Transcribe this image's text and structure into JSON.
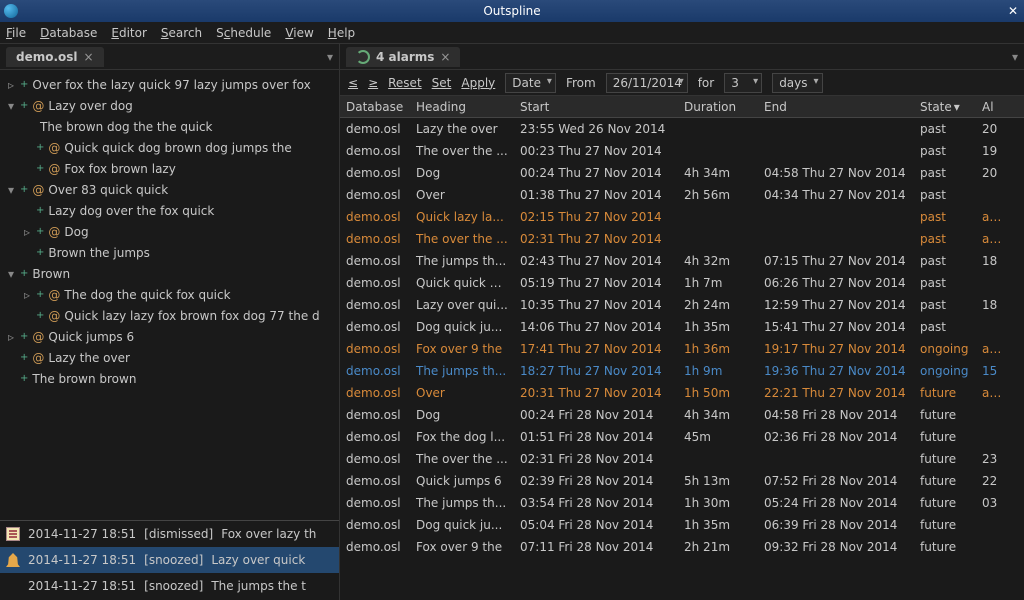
{
  "window": {
    "title": "Outspline"
  },
  "menubar": {
    "file": "File",
    "database": "Database",
    "editor": "Editor",
    "search": "Search",
    "schedule": "Schedule",
    "view": "View",
    "help": "Help"
  },
  "left_tab": {
    "label": "demo.osl"
  },
  "right_tab": {
    "label": "4 alarms"
  },
  "toolbar": {
    "lt": "≤",
    "gt": "≥",
    "reset": "Reset",
    "set": "Set",
    "apply": "Apply",
    "sort": "Date",
    "from_label": "From",
    "date": "26/11/2014",
    "for": "for",
    "days_count": "3",
    "days": "days"
  },
  "tree": [
    {
      "lvl": 0,
      "tw": "▹",
      "b": "+",
      "s": "",
      "text": "Over fox the lazy quick 97 lazy jumps over fox"
    },
    {
      "lvl": 0,
      "tw": "▾",
      "b": "+",
      "s": "@",
      "text": "Lazy over dog"
    },
    {
      "lvl": 1,
      "tw": "",
      "b": "",
      "s": "",
      "text": "The brown dog the the quick"
    },
    {
      "lvl": 1,
      "tw": "",
      "b": "+",
      "s": "@",
      "text": "Quick quick dog brown dog jumps the"
    },
    {
      "lvl": 1,
      "tw": "",
      "b": "+",
      "s": "@",
      "text": "Fox fox brown lazy"
    },
    {
      "lvl": 0,
      "tw": "▾",
      "b": "+",
      "s": "@",
      "text": "Over 83 quick quick"
    },
    {
      "lvl": 1,
      "tw": "",
      "b": "+",
      "s": "",
      "text": "Lazy dog over the fox quick"
    },
    {
      "lvl": 1,
      "tw": "▹",
      "b": "+",
      "s": "@",
      "text": "Dog"
    },
    {
      "lvl": 1,
      "tw": "",
      "b": "+",
      "s": "",
      "text": "Brown the jumps"
    },
    {
      "lvl": 0,
      "tw": "▾",
      "b": "+",
      "s": "",
      "text": "Brown"
    },
    {
      "lvl": 1,
      "tw": "▹",
      "b": "+",
      "s": "@",
      "text": "The dog the quick fox quick"
    },
    {
      "lvl": 1,
      "tw": "",
      "b": "+",
      "s": "@",
      "text": "Quick lazy lazy fox brown fox dog 77 the d"
    },
    {
      "lvl": 0,
      "tw": "▹",
      "b": "+",
      "s": "@",
      "text": "Quick jumps 6"
    },
    {
      "lvl": 0,
      "tw": "",
      "b": "+",
      "s": "@",
      "text": "Lazy the over"
    },
    {
      "lvl": 0,
      "tw": "",
      "b": "+",
      "s": "",
      "text": "The brown brown"
    }
  ],
  "log": [
    {
      "icon": "note",
      "time": "2014-11-27 18:51",
      "status": "[dismissed]",
      "text": "Fox over lazy th",
      "sel": false
    },
    {
      "icon": "bell",
      "time": "2014-11-27 18:51",
      "status": "[snoozed]",
      "text": "Lazy over quick",
      "sel": true
    },
    {
      "icon": "",
      "time": "2014-11-27 18:51",
      "status": "[snoozed]",
      "text": "The jumps the t",
      "sel": false
    }
  ],
  "columns": {
    "database": "Database",
    "heading": "Heading",
    "start": "Start",
    "duration": "Duration",
    "end": "End",
    "state": "State",
    "al": "Al"
  },
  "rows": [
    {
      "db": "demo.osl",
      "hd": "Lazy the over",
      "st": "23:55 Wed 26 Nov 2014",
      "du": "",
      "en": "",
      "state": "past",
      "al": "20",
      "cls": ""
    },
    {
      "db": "demo.osl",
      "hd": "The over the ...",
      "st": "00:23 Thu 27 Nov 2014",
      "du": "",
      "en": "",
      "state": "past",
      "al": "19",
      "cls": ""
    },
    {
      "db": "demo.osl",
      "hd": "Dog",
      "st": "00:24 Thu 27 Nov 2014",
      "du": "4h 34m",
      "en": "04:58 Thu 27 Nov 2014",
      "state": "past",
      "al": "20",
      "cls": ""
    },
    {
      "db": "demo.osl",
      "hd": "Over",
      "st": "01:38 Thu 27 Nov 2014",
      "du": "2h 56m",
      "en": "04:34 Thu 27 Nov 2014",
      "state": "past",
      "al": "",
      "cls": ""
    },
    {
      "db": "demo.osl",
      "hd": "Quick lazy la...",
      "st": "02:15 Thu 27 Nov 2014",
      "du": "",
      "en": "",
      "state": "past",
      "al": "act",
      "cls": "row-orange"
    },
    {
      "db": "demo.osl",
      "hd": "The over the ...",
      "st": "02:31 Thu 27 Nov 2014",
      "du": "",
      "en": "",
      "state": "past",
      "al": "act",
      "cls": "row-orange"
    },
    {
      "db": "demo.osl",
      "hd": "The jumps th...",
      "st": "02:43 Thu 27 Nov 2014",
      "du": "4h 32m",
      "en": "07:15 Thu 27 Nov 2014",
      "state": "past",
      "al": "18",
      "cls": ""
    },
    {
      "db": "demo.osl",
      "hd": "Quick quick d...",
      "st": "05:19 Thu 27 Nov 2014",
      "du": "1h 7m",
      "en": "06:26 Thu 27 Nov 2014",
      "state": "past",
      "al": "",
      "cls": ""
    },
    {
      "db": "demo.osl",
      "hd": "Lazy over qui...",
      "st": "10:35 Thu 27 Nov 2014",
      "du": "2h 24m",
      "en": "12:59 Thu 27 Nov 2014",
      "state": "past",
      "al": "18",
      "cls": ""
    },
    {
      "db": "demo.osl",
      "hd": "Dog quick ju...",
      "st": "14:06 Thu 27 Nov 2014",
      "du": "1h 35m",
      "en": "15:41 Thu 27 Nov 2014",
      "state": "past",
      "al": "",
      "cls": ""
    },
    {
      "db": "demo.osl",
      "hd": "Fox over 9 the",
      "st": "17:41 Thu 27 Nov 2014",
      "du": "1h 36m",
      "en": "19:17 Thu 27 Nov 2014",
      "state": "ongoing",
      "al": "act",
      "cls": "row-orange"
    },
    {
      "db": "demo.osl",
      "hd": "The jumps th...",
      "st": "18:27 Thu 27 Nov 2014",
      "du": "1h 9m",
      "en": "19:36 Thu 27 Nov 2014",
      "state": "ongoing",
      "al": "15",
      "cls": "row-blue"
    },
    {
      "db": "demo.osl",
      "hd": "Over",
      "st": "20:31 Thu 27 Nov 2014",
      "du": "1h 50m",
      "en": "22:21 Thu 27 Nov 2014",
      "state": "future",
      "al": "act",
      "cls": "row-orange"
    },
    {
      "db": "demo.osl",
      "hd": "Dog",
      "st": "00:24 Fri 28 Nov 2014",
      "du": "4h 34m",
      "en": "04:58 Fri 28 Nov 2014",
      "state": "future",
      "al": "",
      "cls": ""
    },
    {
      "db": "demo.osl",
      "hd": "Fox the dog l...",
      "st": "01:51 Fri 28 Nov 2014",
      "du": "45m",
      "en": "02:36 Fri 28 Nov 2014",
      "state": "future",
      "al": "",
      "cls": ""
    },
    {
      "db": "demo.osl",
      "hd": "The over the ...",
      "st": "02:31 Fri 28 Nov 2014",
      "du": "",
      "en": "",
      "state": "future",
      "al": "23",
      "cls": ""
    },
    {
      "db": "demo.osl",
      "hd": "Quick jumps 6",
      "st": "02:39 Fri 28 Nov 2014",
      "du": "5h 13m",
      "en": "07:52 Fri 28 Nov 2014",
      "state": "future",
      "al": "22",
      "cls": ""
    },
    {
      "db": "demo.osl",
      "hd": "The jumps th...",
      "st": "03:54 Fri 28 Nov 2014",
      "du": "1h 30m",
      "en": "05:24 Fri 28 Nov 2014",
      "state": "future",
      "al": "03",
      "cls": ""
    },
    {
      "db": "demo.osl",
      "hd": "Dog quick ju...",
      "st": "05:04 Fri 28 Nov 2014",
      "du": "1h 35m",
      "en": "06:39 Fri 28 Nov 2014",
      "state": "future",
      "al": "",
      "cls": ""
    },
    {
      "db": "demo.osl",
      "hd": "Fox over 9 the",
      "st": "07:11 Fri 28 Nov 2014",
      "du": "2h 21m",
      "en": "09:32 Fri 28 Nov 2014",
      "state": "future",
      "al": "",
      "cls": ""
    }
  ]
}
